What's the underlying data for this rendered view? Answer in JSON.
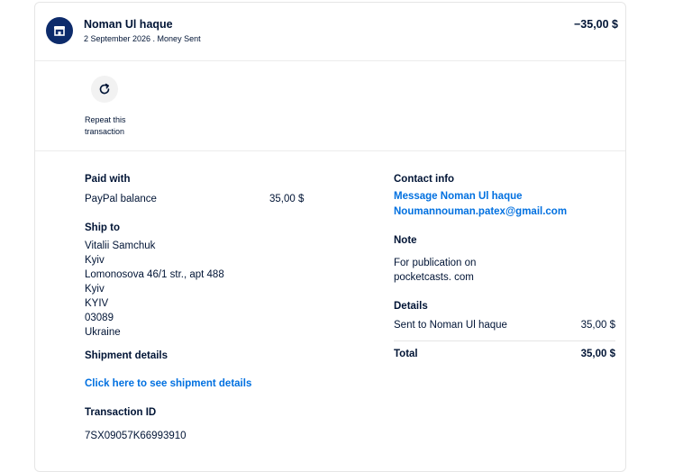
{
  "header": {
    "name": "Noman Ul haque",
    "subtitle": "2 September 2026 . Money Sent",
    "amount": "−35,00 $",
    "avatar_icon": "store-icon",
    "avatar_color": "#0d2b6b"
  },
  "repeat": {
    "label_line1": "Repeat this",
    "label_line2": "transaction",
    "icon": "refresh-icon"
  },
  "paid_with": {
    "heading": "Paid with",
    "method": "PayPal balance",
    "amount": "35,00 $"
  },
  "ship_to": {
    "heading": "Ship to",
    "lines": [
      "Vitalii Samchuk",
      "Kyiv",
      "Lomonosova 46/1 str., apt 488",
      "Kyiv",
      "KYIV",
      "03089",
      "Ukraine"
    ]
  },
  "shipment_details": {
    "heading": "Shipment details",
    "link": "Click here to see shipment details"
  },
  "transaction_id": {
    "heading": "Transaction ID",
    "value": "7SX09057K66993910"
  },
  "contact_info": {
    "heading": "Contact info",
    "message_link": "Message Noman Ul haque",
    "email": "Noumannouman.patex@gmail.com"
  },
  "note": {
    "heading": "Note",
    "line1": "For publication on",
    "line2": "pocketcasts. com"
  },
  "details": {
    "heading": "Details",
    "sent_label": "Sent to Noman Ul haque",
    "sent_amount": "35,00 $",
    "total_label": "Total",
    "total_amount": "35,00 $"
  },
  "colors": {
    "text": "#001435",
    "link": "#0070e0"
  }
}
